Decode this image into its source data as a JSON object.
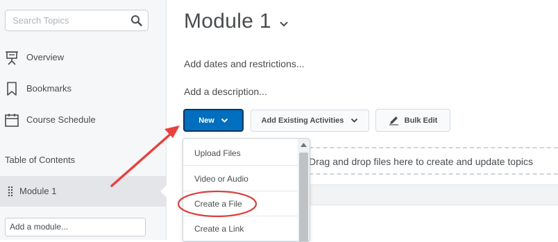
{
  "sidebar": {
    "search_placeholder": "Search Topics",
    "search_icon": "search-icon",
    "items": [
      {
        "label": "Overview",
        "icon": "presentation-icon"
      },
      {
        "label": "Bookmarks",
        "icon": "bookmark-icon"
      },
      {
        "label": "Course Schedule",
        "icon": "calendar-icon"
      }
    ],
    "toc_label": "Table of Contents",
    "module_label": "Module 1",
    "add_module_placeholder": "Add a module..."
  },
  "main": {
    "title": "Module 1",
    "dates_link": "Add dates and restrictions...",
    "description_link": "Add a description...",
    "new_button": "New",
    "add_existing_button": "Add Existing Activities",
    "bulk_edit_button": "Bulk Edit",
    "dropzone_text": "Drag and drop files here to create and update topics"
  },
  "new_menu": {
    "items": [
      "Upload Files",
      "Video or Audio",
      "Create a File",
      "Create a Link"
    ]
  },
  "annotation_colors": {
    "arrow": "#e8413e",
    "highlight_ring": "#d9403d",
    "primary_button": "#006fbf"
  }
}
